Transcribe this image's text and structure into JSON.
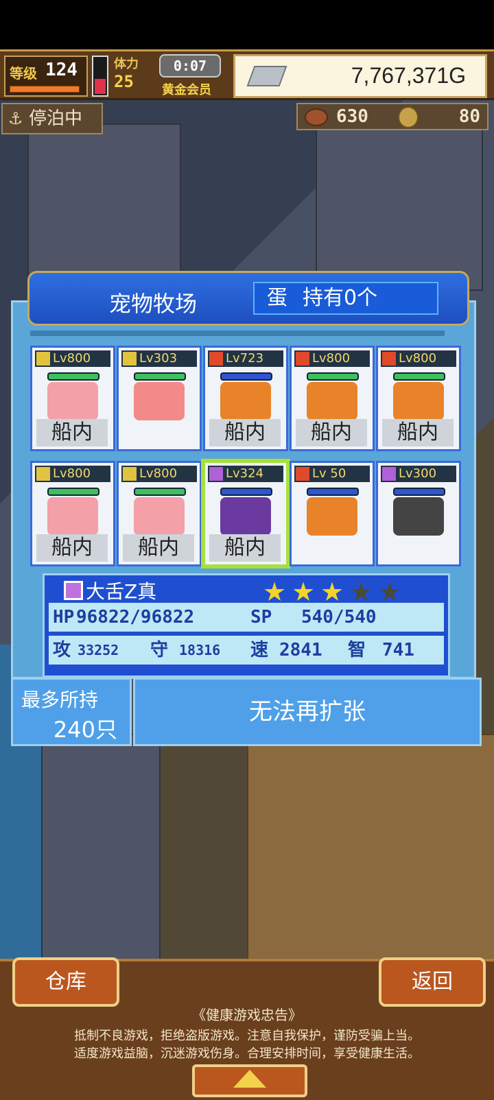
{
  "status": {
    "level_label": "等级",
    "level": "124",
    "stamina_label": "体力",
    "stamina": "25",
    "timer": "0:07",
    "vip": "黄金会员",
    "gold": "7,767,371G",
    "moored": "停泊中",
    "meat": "630",
    "coins": "80"
  },
  "dialog": {
    "title": "宠物牧场",
    "egg_label": "蛋",
    "egg_count": "持有0个"
  },
  "pets": [
    {
      "lv": "Lv800",
      "element": "yellow",
      "location": "船内",
      "hp_color": "#3fbf5f",
      "sprite_color": "#f3a0a8"
    },
    {
      "lv": "Lv303",
      "element": "yellow",
      "location": "",
      "hp_color": "#3fbf5f",
      "sprite_color": "#f38a8a"
    },
    {
      "lv": "Lv723",
      "element": "red",
      "location": "船内",
      "hp_color": "#2f55d0",
      "sprite_color": "#e8832a"
    },
    {
      "lv": "Lv800",
      "element": "red",
      "location": "船内",
      "hp_color": "#3fbf5f",
      "sprite_color": "#e8832a"
    },
    {
      "lv": "Lv800",
      "element": "red",
      "location": "船内",
      "hp_color": "#3fbf5f",
      "sprite_color": "#e8832a"
    },
    {
      "lv": "Lv800",
      "element": "yellow",
      "location": "船内",
      "hp_color": "#3fbf5f",
      "sprite_color": "#f3a0a8"
    },
    {
      "lv": "Lv800",
      "element": "yellow",
      "location": "船内",
      "hp_color": "#3fbf5f",
      "sprite_color": "#f3a0a8"
    },
    {
      "lv": "Lv324",
      "element": "purple",
      "location": "船内",
      "hp_color": "#2f55d0",
      "sprite_color": "#6a3aa0",
      "selected": true
    },
    {
      "lv": "Lv 50",
      "element": "red",
      "location": "",
      "hp_color": "#2f55d0",
      "sprite_color": "#e8832a"
    },
    {
      "lv": "Lv300",
      "element": "purple",
      "location": "",
      "hp_color": "#2f55d0",
      "sprite_color": "#444"
    }
  ],
  "selected_pet": {
    "name": "大舌Z真",
    "stars": 3,
    "max_stars": 5,
    "hp_label": "HP",
    "hp": "96822/96822",
    "sp_label": "SP",
    "sp": "540/540",
    "atk_label": "攻",
    "atk": "33252",
    "def_label": "守",
    "def": "18316",
    "spd_label": "速",
    "spd": "2841",
    "int_label": "智",
    "int": "741"
  },
  "capacity": {
    "label": "最多所持",
    "value": "240只",
    "expand_label": "无法再扩张"
  },
  "bottom": {
    "warehouse": "仓库",
    "back": "返回",
    "notice_title": "《健康游戏忠告》",
    "notice_line1": "抵制不良游戏，拒绝盗版游戏。注意自我保护，谨防受骗上当。",
    "notice_line2": "适度游戏益脑，沉迷游戏伤身。合理安排时间，享受健康生活。"
  },
  "colors": {
    "element_yellow": "#e2c340",
    "element_red": "#e04a2a",
    "element_purple": "#b060d8",
    "star_on": "#f4d32a",
    "star_off": "#4a4a3a"
  }
}
